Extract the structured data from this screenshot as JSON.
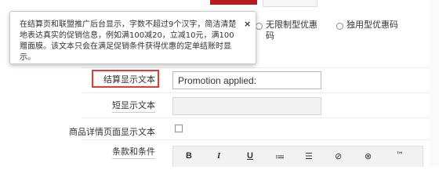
{
  "tooltip": {
    "text": "在结算页和联盟推广后台显示，字数不超过9个汉字，简洁清楚地表达真实的促销信息，例如满100减20，立减10元，满100赠面膜。该文本只会在满足促销条件获得优惠的定单结账时显示。",
    "close_glyph": "×"
  },
  "coupon_type": {
    "options": [
      {
        "label": "无限制型优惠码"
      },
      {
        "label": "独用型优惠码"
      }
    ]
  },
  "fields": {
    "checkout_text": {
      "label": "结算显示文本",
      "value": "Promotion applied:"
    },
    "short_text": {
      "label": "短显示文本",
      "value": ""
    },
    "product_detail": {
      "label": "商品详情页面显示文本"
    },
    "terms": {
      "label": "条款和条件"
    }
  },
  "toolbar": {
    "bold": "B",
    "italic": "I",
    "underline": "U",
    "ordered_list": "≔",
    "unordered_list": "☰",
    "link": "⊘",
    "unlink": "⊗",
    "trademark": "™"
  },
  "colors": {
    "highlight": "#e53935",
    "brand_red": "#b71c1c"
  }
}
